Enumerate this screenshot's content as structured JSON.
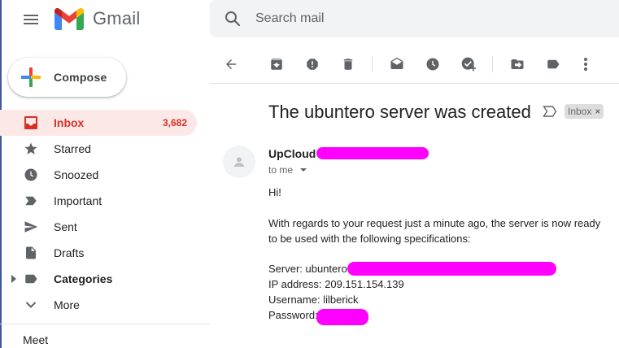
{
  "header": {
    "app_name": "Gmail",
    "search_placeholder": "Search mail"
  },
  "compose": {
    "label": "Compose"
  },
  "sidebar": {
    "items": [
      {
        "label": "Inbox",
        "count": "3,682",
        "icon": "inbox-icon",
        "active": true
      },
      {
        "label": "Starred",
        "icon": "star-icon"
      },
      {
        "label": "Snoozed",
        "icon": "clock-icon"
      },
      {
        "label": "Important",
        "icon": "important-icon"
      },
      {
        "label": "Sent",
        "icon": "send-icon"
      },
      {
        "label": "Drafts",
        "icon": "draft-icon"
      },
      {
        "label": "Categories",
        "icon": "label-icon"
      },
      {
        "label": "More",
        "icon": "chevron-down-icon"
      }
    ],
    "meet_label": "Meet"
  },
  "toolbar": {
    "icons": [
      "back-icon",
      "archive-icon",
      "report-spam-icon",
      "delete-icon",
      "mark-unread-icon",
      "snooze-icon",
      "add-task-icon",
      "move-to-icon",
      "labels-icon",
      "more-vert-icon"
    ]
  },
  "message": {
    "subject": "The ubuntero server was created",
    "label_chip": "Inbox",
    "label_chip_close": "×",
    "sender_name": "UpCloud",
    "recipient": "to me",
    "greeting": "Hi!",
    "paragraph_line1": "With regards to your request just a minute ago, the server is now ready",
    "paragraph_line2": "to be used with the following specifications:",
    "server_line": "Server: ubuntero",
    "ip_line": "IP address: 209.151.154.139",
    "username_line": "Username: lilberick",
    "password_line": "Password:"
  },
  "colors": {
    "accent_red": "#d93025",
    "active_bg": "#fce8e6",
    "redaction": "#ff00ff",
    "search_bg": "#f1f3f4"
  }
}
